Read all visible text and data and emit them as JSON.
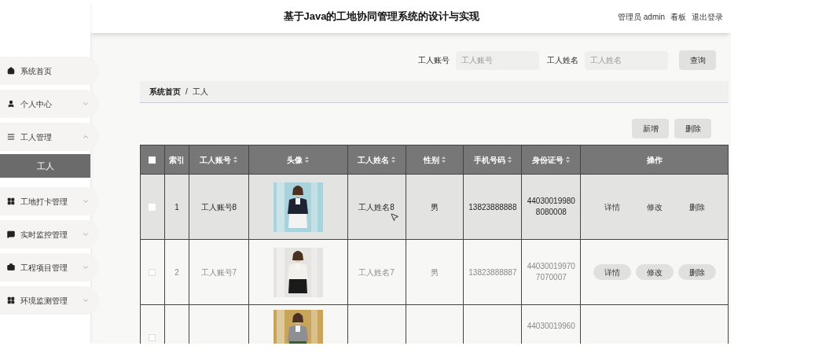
{
  "header": {
    "title": "基于Java的工地协同管理系统的设计与实现",
    "user": "管理员 admin",
    "links": [
      "看板",
      "退出登录"
    ]
  },
  "sidebar": {
    "items": [
      {
        "label": "系统首页"
      },
      {
        "label": "个人中心",
        "expanded": false
      },
      {
        "label": "工人管理",
        "expanded": true,
        "children": [
          {
            "label": "工人",
            "selected": true
          }
        ]
      },
      {
        "label": "工地打卡管理",
        "expanded": false
      },
      {
        "label": "实时监控管理",
        "expanded": false
      },
      {
        "label": "工程项目管理",
        "expanded": false
      },
      {
        "label": "环境监测管理",
        "expanded": false
      }
    ]
  },
  "search": {
    "fields": [
      {
        "label": "工人账号",
        "placeholder": "工人账号"
      },
      {
        "label": "工人姓名",
        "placeholder": "工人姓名"
      }
    ],
    "button": "查询"
  },
  "breadcrumb": {
    "items": [
      "系统首页",
      "工人"
    ],
    "separator": "/"
  },
  "actions": [
    "新增",
    "删除"
  ],
  "table": {
    "select_all_checked": false,
    "columns": [
      {
        "label": "索引",
        "sortable": false
      },
      {
        "label": "工人账号",
        "sortable": true
      },
      {
        "label": "头像",
        "sortable": true
      },
      {
        "label": "工人姓名",
        "sortable": true
      },
      {
        "label": "性别",
        "sortable": true
      },
      {
        "label": "手机号码",
        "sortable": true
      },
      {
        "label": "身份证号",
        "sortable": true
      },
      {
        "label": "操作",
        "sortable": false
      }
    ],
    "rows": [
      {
        "hovered": true,
        "checked": false,
        "index": "1",
        "account": "工人账号8",
        "photo": {
          "kind": "picture"
        },
        "name": "工人姓名8",
        "gender": "男",
        "phone": "13823888888",
        "id_number": [
          "44030019980",
          "8080008"
        ],
        "buttons": [
          "详情",
          "修改",
          "删除"
        ]
      },
      {
        "hovered": false,
        "checked": false,
        "index": "2",
        "account": "工人账号7",
        "photo": {
          "kind": "picture"
        },
        "name": "工人姓名7",
        "gender": "男",
        "phone": "13823888887",
        "id_number": [
          "44030019970",
          "7070007"
        ],
        "buttons": [
          "详情",
          "修改",
          "删除"
        ]
      },
      {
        "hovered": false,
        "checked": false,
        "photo": {
          "kind": "picture"
        },
        "id_number": [
          "44030019960"
        ]
      }
    ]
  }
}
